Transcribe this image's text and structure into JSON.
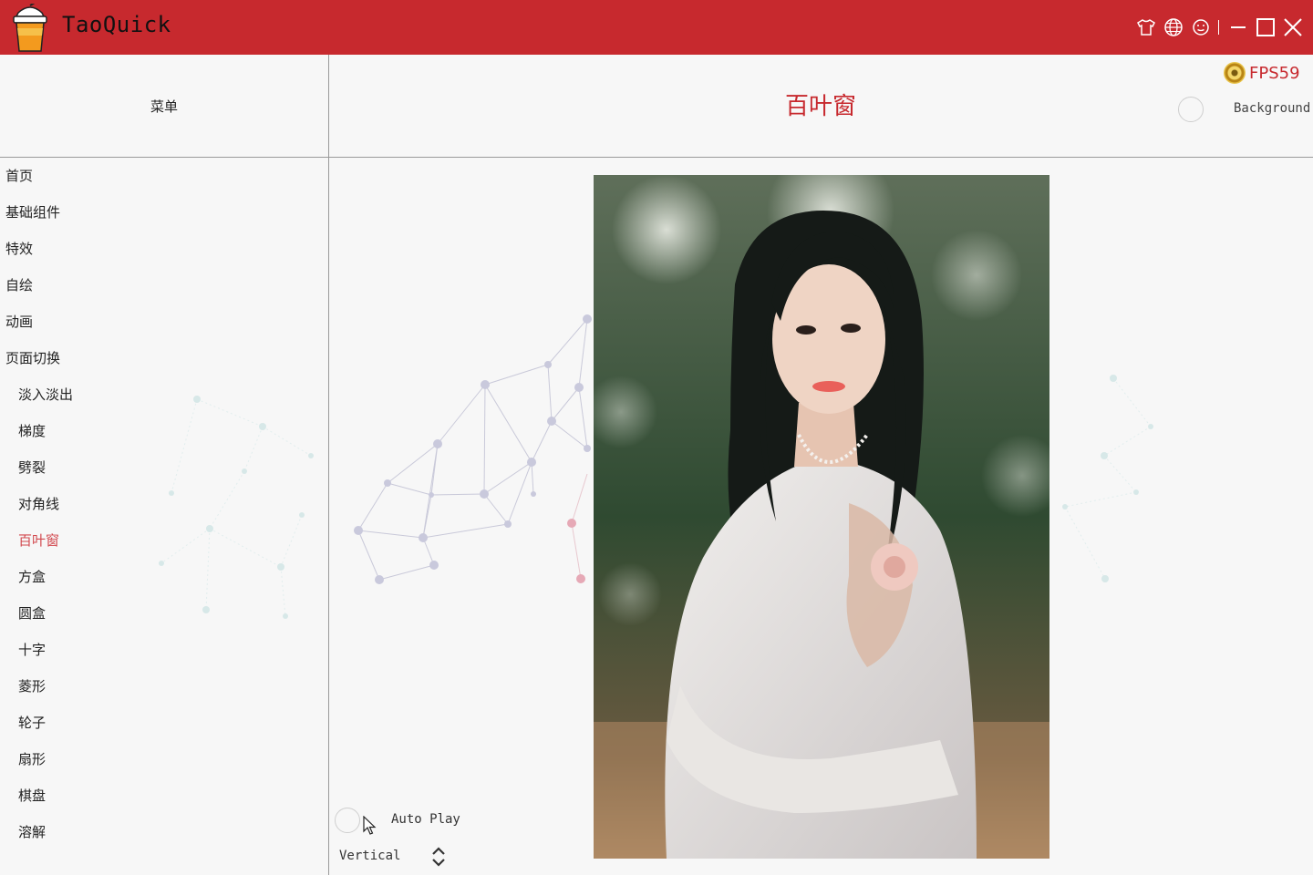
{
  "app": {
    "title": "TaoQuick",
    "brand_color": "#c7292e",
    "icons": [
      "skin-icon",
      "language-icon",
      "about-icon",
      "minimize-icon",
      "maximize-icon",
      "close-icon"
    ]
  },
  "sidebar": {
    "header": "菜单",
    "items": [
      {
        "label": "首页",
        "level": 0
      },
      {
        "label": "基础组件",
        "level": 0
      },
      {
        "label": "特效",
        "level": 0
      },
      {
        "label": "自绘",
        "level": 0
      },
      {
        "label": "动画",
        "level": 0
      },
      {
        "label": "页面切换",
        "level": 0
      },
      {
        "label": "淡入淡出",
        "level": 1
      },
      {
        "label": "梯度",
        "level": 1
      },
      {
        "label": "劈裂",
        "level": 1
      },
      {
        "label": "对角线",
        "level": 1
      },
      {
        "label": "百叶窗",
        "level": 1,
        "active": true
      },
      {
        "label": "方盒",
        "level": 1
      },
      {
        "label": "圆盒",
        "level": 1
      },
      {
        "label": "十字",
        "level": 1
      },
      {
        "label": "菱形",
        "level": 1
      },
      {
        "label": "轮子",
        "level": 1
      },
      {
        "label": "扇形",
        "level": 1
      },
      {
        "label": "棋盘",
        "level": 1
      },
      {
        "label": "溶解",
        "level": 1
      }
    ],
    "active_color": "#d2484e"
  },
  "content": {
    "title": "百叶窗",
    "fps_text": "FPS59",
    "background_label": "Background",
    "autoplay_label": "Auto Play",
    "direction_value": "Vertical"
  }
}
